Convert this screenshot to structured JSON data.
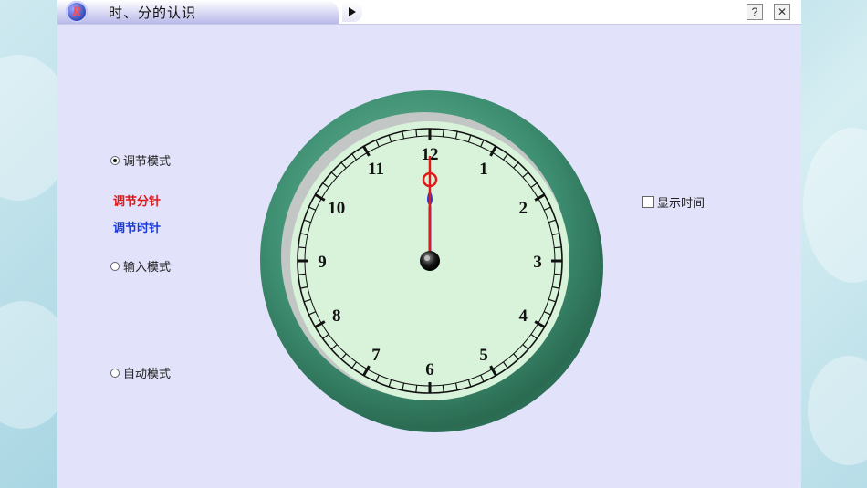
{
  "window": {
    "title": "时、分的认识",
    "logo_letter": "R",
    "help_label": "?",
    "close_label": "✕"
  },
  "modes": {
    "adjust_mode": "调节模式",
    "adjust_minute": "调节分针",
    "adjust_hour": "调节时针",
    "input_mode": "输入模式",
    "auto_mode": "自动模式",
    "selected": "adjust_mode"
  },
  "show_time": {
    "label": "显示时间",
    "checked": false
  },
  "clock": {
    "hour": 12,
    "minute": 0,
    "numerals": [
      "12",
      "1",
      "2",
      "3",
      "4",
      "5",
      "6",
      "7",
      "8",
      "9",
      "10",
      "11"
    ],
    "colors": {
      "rim": "#3e8f72",
      "face": "#d8f3da",
      "minute_hand": "#e01818",
      "hour_hand": "#1a3bd8"
    }
  },
  "icons": {
    "play": "play-triangle-icon",
    "help": "help-icon",
    "close": "close-icon"
  }
}
